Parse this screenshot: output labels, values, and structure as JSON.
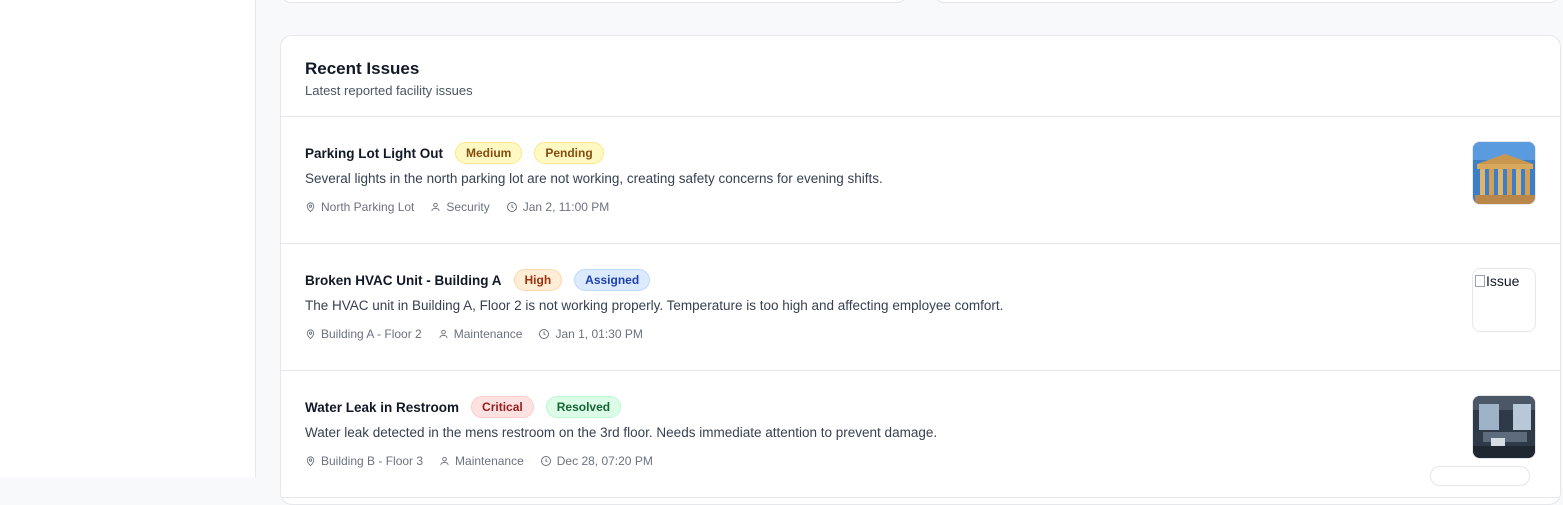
{
  "section": {
    "title": "Recent Issues",
    "subtitle": "Latest reported facility issues"
  },
  "issues": [
    {
      "title": "Parking Lot Light Out",
      "priority": "Medium",
      "status": "Pending",
      "description": "Several lights in the north parking lot are not working, creating safety concerns for evening shifts.",
      "location": "North Parking Lot",
      "assignee": "Security",
      "time": "Jan 2, 11:00 PM",
      "image": "temple-photo"
    },
    {
      "title": "Broken HVAC Unit - Building A",
      "priority": "High",
      "status": "Assigned",
      "description": "The HVAC unit in Building A, Floor 2 is not working properly. Temperature is too high and affecting employee comfort.",
      "location": "Building A - Floor 2",
      "assignee": "Maintenance",
      "time": "Jan 1, 01:30 PM",
      "image_alt": "Issue"
    },
    {
      "title": "Water Leak in Restroom",
      "priority": "Critical",
      "status": "Resolved",
      "description": "Water leak detected in the mens restroom on the 3rd floor. Needs immediate attention to prevent damage.",
      "location": "Building B - Floor 3",
      "assignee": "Maintenance",
      "time": "Dec 28, 07:20 PM",
      "image": "interior-photo"
    }
  ],
  "colors": {
    "medium_bg": "#fef9c3",
    "medium_border": "#fde68a",
    "medium_text": "#854d0e",
    "pending_bg": "#fef9c3",
    "pending_border": "#fde68a",
    "pending_text": "#854d0e",
    "high_bg": "#ffedd5",
    "high_border": "#fed7aa",
    "high_text": "#9a3412",
    "assigned_bg": "#dbeafe",
    "assigned_border": "#bfdbfe",
    "assigned_text": "#1e40af",
    "critical_bg": "#fee2e2",
    "critical_border": "#fecaca",
    "critical_text": "#991b1b",
    "resolved_bg": "#dcfce7",
    "resolved_border": "#bbf7d0",
    "resolved_text": "#166534"
  },
  "icons": {
    "location": "map-pin-icon",
    "assignee": "user-icon",
    "time": "clock-icon"
  }
}
